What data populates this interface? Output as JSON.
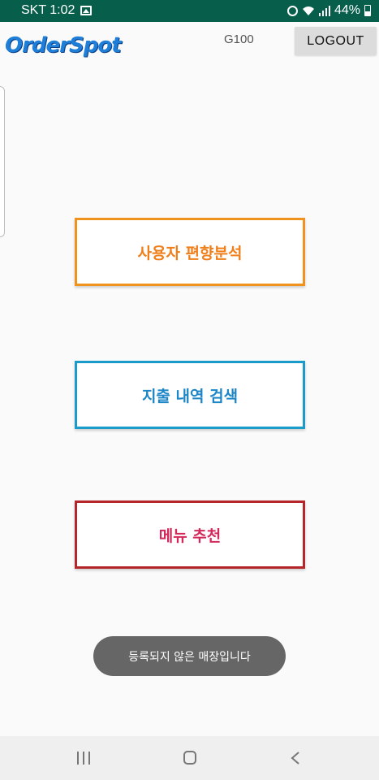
{
  "status_bar": {
    "carrier_time": "SKT 1:02",
    "battery": "44%",
    "icons": [
      "gallery-icon",
      "alarm-icon",
      "wifi-icon",
      "signal-icon",
      "battery-icon"
    ]
  },
  "header": {
    "logo_text": "OrderSpot",
    "store_code": "G100",
    "logout_label": "LOGOUT"
  },
  "menu": {
    "buttons": [
      {
        "label": "사용자 편향분석",
        "color": "#f0921e"
      },
      {
        "label": "지출 내역 검색",
        "color": "#1a9bc9"
      },
      {
        "label": "메뉴 추천",
        "color": "#b5262a"
      }
    ]
  },
  "toast": {
    "message": "등록되지 않은 매장입니다"
  },
  "nav_bar": {
    "icons": [
      "recents-icon",
      "home-icon",
      "back-icon"
    ]
  }
}
